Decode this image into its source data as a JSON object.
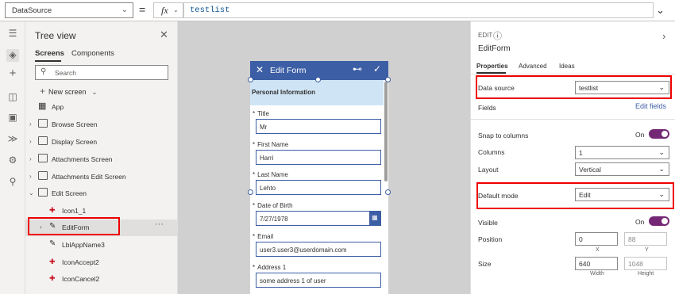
{
  "formula_bar": {
    "property": "DataSource",
    "equals": "=",
    "fx": "fx",
    "formula": "testlist"
  },
  "tree": {
    "title": "Tree view",
    "tabs": [
      "Screens",
      "Components"
    ],
    "search_placeholder": "Search",
    "new_screen": "New screen",
    "items": [
      {
        "label": "App"
      },
      {
        "label": "Browse Screen"
      },
      {
        "label": "Display Screen"
      },
      {
        "label": "Attachments Screen"
      },
      {
        "label": "Attachments Edit Screen"
      },
      {
        "label": "Edit Screen"
      },
      {
        "label": "Icon1_1"
      },
      {
        "label": "EditForm"
      },
      {
        "label": "LblAppName3"
      },
      {
        "label": "IconAccept2"
      },
      {
        "label": "IconCancel2"
      }
    ],
    "more": "···"
  },
  "form": {
    "header_title": "Edit Form",
    "section": "Personal Information",
    "fields": [
      {
        "label": "Title",
        "value": "Mr"
      },
      {
        "label": "First Name",
        "value": "Harri"
      },
      {
        "label": "Last Name",
        "value": "Lehto"
      },
      {
        "label": "Date of Birth",
        "value": "7/27/1978"
      },
      {
        "label": "Email",
        "value": "user3.user3@userdomain.com"
      },
      {
        "label": "Address 1",
        "value": "some address 1 of user"
      }
    ],
    "required_mark": "*"
  },
  "props": {
    "kind": "EDIT",
    "control_name": "EditForm",
    "tabs": [
      "Properties",
      "Advanced",
      "Ideas"
    ],
    "data_source_label": "Data source",
    "data_source_value": "testlist",
    "fields_label": "Fields",
    "edit_fields": "Edit fields",
    "snap_label": "Snap to columns",
    "snap_state": "On",
    "columns_label": "Columns",
    "columns_value": "1",
    "layout_label": "Layout",
    "layout_value": "Vertical",
    "default_mode_label": "Default mode",
    "default_mode_value": "Edit",
    "visible_label": "Visible",
    "visible_state": "On",
    "position_label": "Position",
    "position_x": "0",
    "position_y": "88",
    "x_label": "X",
    "y_label": "Y",
    "size_label": "Size",
    "width_value": "640",
    "height_value": "1048",
    "width_label": "Width",
    "height_label": "Height"
  },
  "colors": {
    "accent": "#3c5ea5",
    "highlight": "#e00000",
    "toggle": "#742774"
  }
}
